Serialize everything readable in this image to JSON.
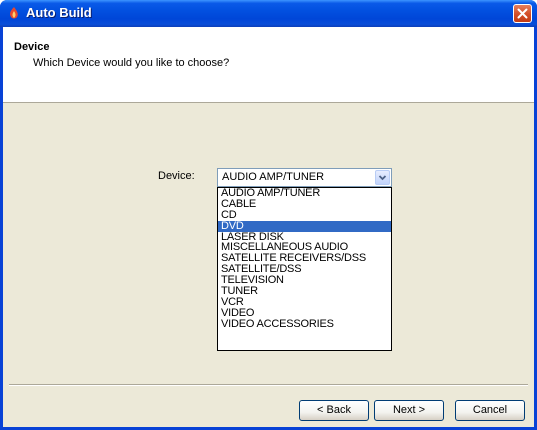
{
  "window": {
    "title": "Auto Build"
  },
  "header": {
    "title": "Device",
    "subtitle": "Which Device would you like to choose?"
  },
  "form": {
    "device_label": "Device:",
    "selected_value": "AUDIO AMP/TUNER",
    "highlighted_option": "DVD",
    "options": [
      "AUDIO AMP/TUNER",
      "CABLE",
      "CD",
      "DVD",
      "LASER DISK",
      "MISCELLANEOUS AUDIO",
      "SATELLITE RECEIVERS/DSS",
      "SATELLITE/DSS",
      "TELEVISION",
      "TUNER",
      "VCR",
      "VIDEO",
      "VIDEO ACCESSORIES"
    ]
  },
  "buttons": {
    "back": "< Back",
    "next": "Next >",
    "cancel": "Cancel"
  },
  "colors": {
    "titlebar": "#0054e3",
    "selection": "#316ac5",
    "dialog_bg": "#ece9d8",
    "close": "#d24d27"
  },
  "icons": {
    "app": "app-flame-icon",
    "close": "close-icon",
    "dropdown": "chevron-down-icon"
  }
}
